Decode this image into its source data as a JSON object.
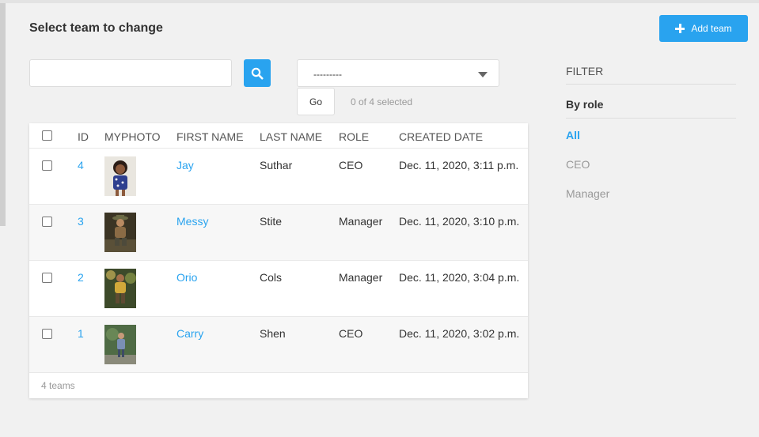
{
  "header": {
    "title": "Select team to change",
    "add_label": "Add team"
  },
  "search": {
    "value": "",
    "placeholder": ""
  },
  "actions": {
    "selected": "---------",
    "go_label": "Go",
    "selection_count": "0 of 4 selected"
  },
  "table": {
    "columns": [
      "ID",
      "MYPHOTO",
      "FIRST NAME",
      "LAST NAME",
      "ROLE",
      "CREATED DATE"
    ],
    "rows": [
      {
        "id": "4",
        "first_name": "Jay",
        "last_name": "Suthar",
        "role": "CEO",
        "created": "Dec. 11, 2020, 3:11 p.m."
      },
      {
        "id": "3",
        "first_name": "Messy",
        "last_name": "Stite",
        "role": "Manager",
        "created": "Dec. 11, 2020, 3:10 p.m."
      },
      {
        "id": "2",
        "first_name": "Orio",
        "last_name": "Cols",
        "role": "Manager",
        "created": "Dec. 11, 2020, 3:04 p.m."
      },
      {
        "id": "1",
        "first_name": "Carry",
        "last_name": "Shen",
        "role": "CEO",
        "created": "Dec. 11, 2020, 3:02 p.m."
      }
    ],
    "footer": "4 teams"
  },
  "filter": {
    "title": "FILTER",
    "group": "By role",
    "options": [
      "All",
      "CEO",
      "Manager"
    ]
  },
  "colors": {
    "accent": "#29a3ef",
    "background": "#f1f1f1"
  }
}
